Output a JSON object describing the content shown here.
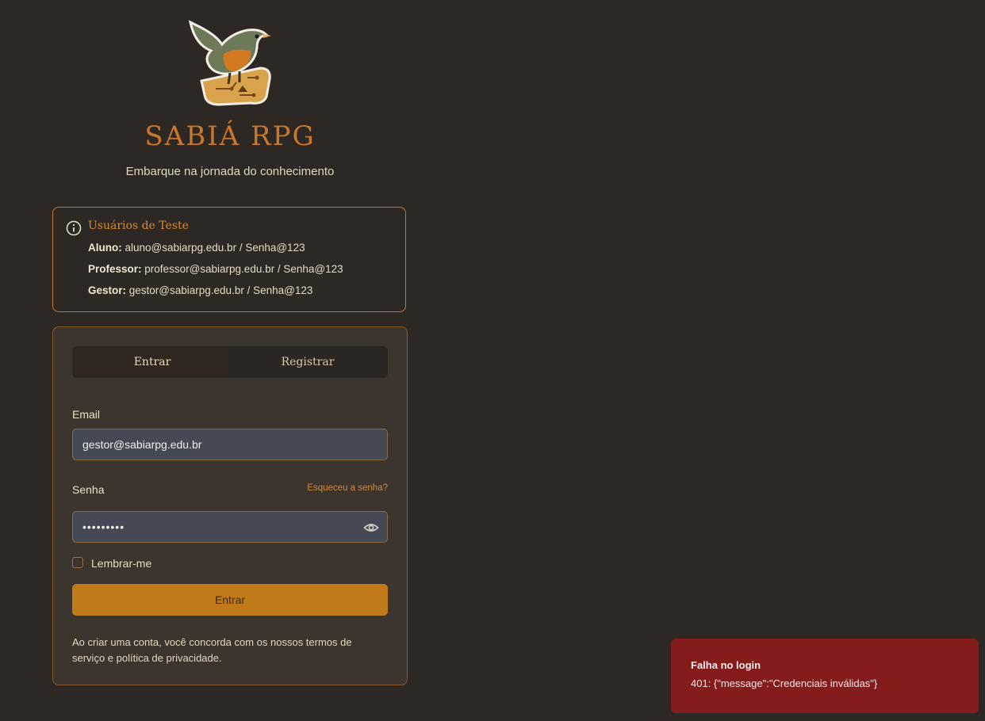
{
  "brand": {
    "name": "SABIÁ RPG",
    "tagline": "Embarque na jornada do conhecimento",
    "logo_icon": "sabia-bird-logo-icon"
  },
  "test_users": {
    "title": "Usuários de Teste",
    "icon": "info-icon",
    "users": [
      {
        "role": "Aluno:",
        "credentials": "aluno@sabiarpg.edu.br / Senha@123"
      },
      {
        "role": "Professor:",
        "credentials": "professor@sabiarpg.edu.br / Senha@123"
      },
      {
        "role": "Gestor:",
        "credentials": "gestor@sabiarpg.edu.br / Senha@123"
      }
    ]
  },
  "auth": {
    "tabs": [
      {
        "label": "Entrar",
        "active": true
      },
      {
        "label": "Registrar",
        "active": false
      }
    ],
    "email_label": "Email",
    "email_value": "gestor@sabiarpg.edu.br",
    "password_label": "Senha",
    "forgot_link": "Esqueceu a senha?",
    "password_masked": "•••••••••",
    "remember_label": "Lembrar-me",
    "remember_checked": false,
    "submit_label": "Entrar",
    "terms": "Ao criar uma conta, você concorda com os nossos termos de serviço e política de privacidade."
  },
  "toast": {
    "title": "Falha no login",
    "message": "401: {\"message\":\"Credenciais inválidas\"}"
  },
  "colors": {
    "background": "#2d2823",
    "accent": "#c07a1a",
    "error": "#851c1c"
  }
}
